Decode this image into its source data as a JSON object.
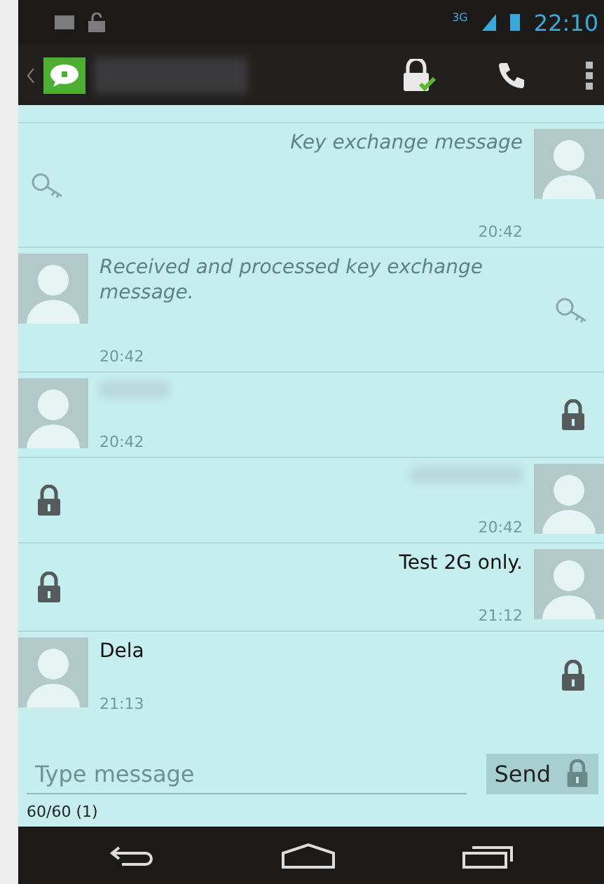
{
  "status_bar": {
    "time": "22:10",
    "network": "3G"
  },
  "messages": [
    {
      "sent": true,
      "kind": "system",
      "text": "Key exchange message",
      "time": "20:42"
    },
    {
      "sent": false,
      "kind": "system",
      "text": "Received and processed key exchange message.",
      "time": "20:42"
    },
    {
      "sent": false,
      "kind": "redacted",
      "time": "20:42"
    },
    {
      "sent": true,
      "kind": "redacted",
      "time": "20:42"
    },
    {
      "sent": true,
      "kind": "text",
      "text": "Test 2G only.",
      "time": "21:12"
    },
    {
      "sent": false,
      "kind": "text",
      "text": "Dela",
      "time": "21:13"
    }
  ],
  "composer": {
    "placeholder": "Type message",
    "send_label": "Send",
    "counter": "60/60 (1)"
  }
}
